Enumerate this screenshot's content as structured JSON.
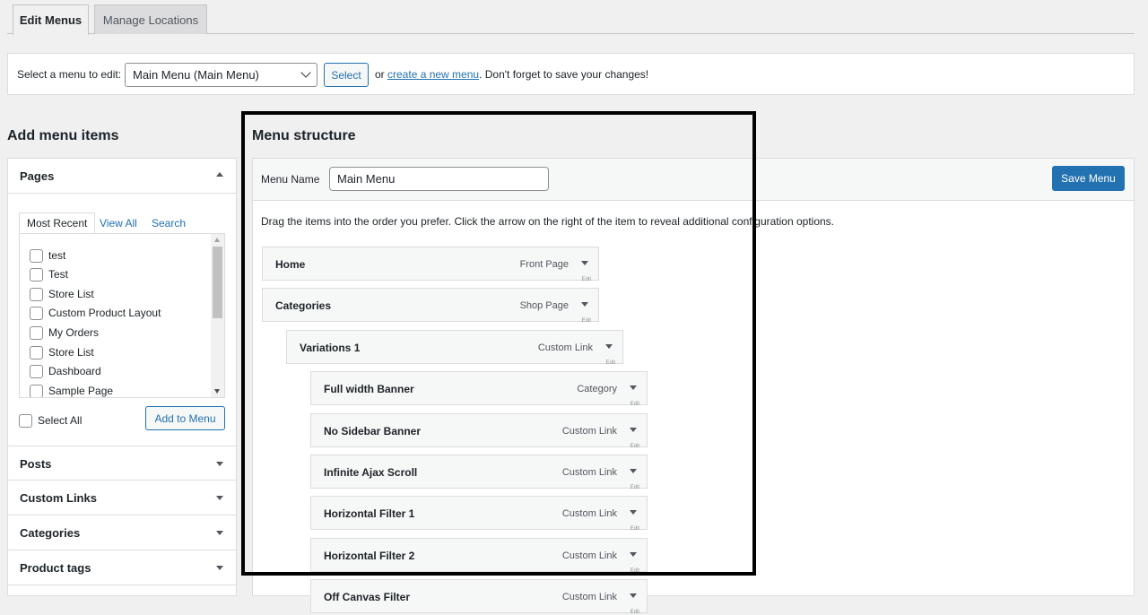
{
  "tabs": {
    "edit_menus": "Edit Menus",
    "manage_locations": "Manage Locations"
  },
  "select_bar": {
    "label": "Select a menu to edit:",
    "selected_menu": "Main Menu (Main Menu)",
    "select_button": "Select",
    "or_text": "or ",
    "create_link": "create a new menu",
    "suffix": ". Don't forget to save your changes!"
  },
  "add_items": {
    "heading": "Add menu items",
    "pages": {
      "title": "Pages",
      "tabs": [
        "Most Recent",
        "View All",
        "Search"
      ],
      "items": [
        "test",
        "Test",
        "Store List",
        "Custom Product Layout",
        "My Orders",
        "Store List",
        "Dashboard",
        "Sample Page"
      ],
      "select_all": "Select All",
      "add_button": "Add to Menu"
    },
    "sections": [
      "Posts",
      "Custom Links",
      "Categories",
      "Product tags"
    ]
  },
  "structure": {
    "heading": "Menu structure",
    "name_label": "Menu Name",
    "name_value": "Main Menu",
    "save_button": "Save Menu",
    "instructions": "Drag the items into the order you prefer. Click the arrow on the right of the item to reveal additional configuration options.",
    "edit_label": "Edit",
    "items": [
      {
        "title": "Home",
        "type": "Front Page",
        "depth": 0
      },
      {
        "title": "Categories",
        "type": "Shop Page",
        "depth": 0
      },
      {
        "title": "Variations 1",
        "type": "Custom Link",
        "depth": 1
      },
      {
        "title": "Full width Banner",
        "type": "Category",
        "depth": 2
      },
      {
        "title": "No Sidebar Banner",
        "type": "Custom Link",
        "depth": 2
      },
      {
        "title": "Infinite Ajax Scroll",
        "type": "Custom Link",
        "depth": 2
      },
      {
        "title": "Horizontal Filter 1",
        "type": "Custom Link",
        "depth": 2
      },
      {
        "title": "Horizontal Filter 2",
        "type": "Custom Link",
        "depth": 2
      },
      {
        "title": "Off Canvas Filter",
        "type": "Custom Link",
        "depth": 2
      }
    ]
  },
  "colors": {
    "accent": "#2271b1",
    "text": "#1d2327",
    "border": "#dcdcde",
    "background": "#f0f0f1"
  }
}
